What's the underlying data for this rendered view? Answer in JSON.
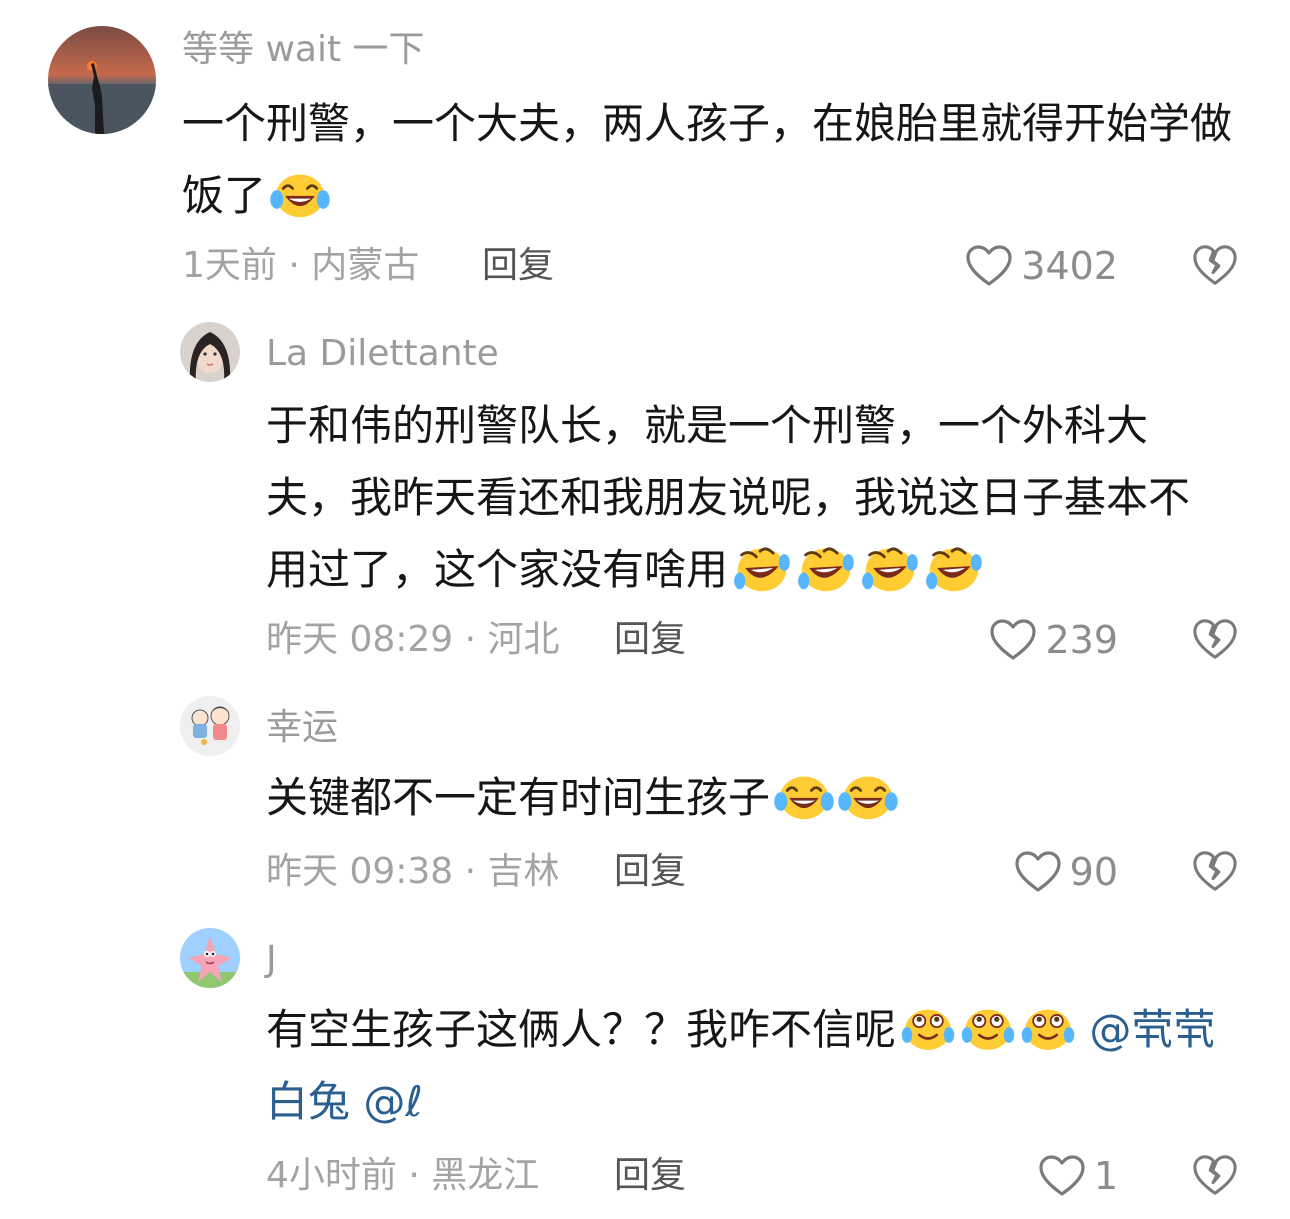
{
  "comments": [
    {
      "username": "等等 wait 一下",
      "text": "一个刑警，一个大夫，两人孩子，在娘胎里就得开始学做饭了",
      "emoji": "laugh-cry",
      "emoji_count": 1,
      "time_location": "1天前 · 内蒙古",
      "reply_label": "回复",
      "likes": "3402",
      "avatar": "sunset-silhouette-avatar"
    },
    {
      "username": "La  Dilettante",
      "text": "于和伟的刑警队长，就是一个刑警，一个外科大夫，我昨天看还和我朋友说呢，我说这日子基本不用过了，这个家没有啥用",
      "emoji": "rofl",
      "emoji_count": 4,
      "time_location": "昨天 08:29 · 河北",
      "reply_label": "回复",
      "likes": "239",
      "avatar": "girl-portrait-avatar"
    },
    {
      "username": "幸运",
      "text": "关键都不一定有时间生孩子",
      "emoji": "laugh-cry",
      "emoji_count": 2,
      "time_location": "昨天 09:38 · 吉林",
      "reply_label": "回复",
      "likes": "90",
      "avatar": "cartoon-kids-avatar"
    },
    {
      "username": "J",
      "text": "有空生孩子这俩人？？我咋不信呢",
      "emoji": "tearful-laugh",
      "emoji_count": 3,
      "mentions": [
        "@茕茕白兔",
        "@ℓ"
      ],
      "time_location": "4小时前 · 黑龙江",
      "reply_label": "回复",
      "likes": "1",
      "avatar": "patrick-star-avatar"
    }
  ],
  "colors": {
    "username": "#9b9b9b",
    "content": "#161616",
    "meta": "#a3a3a3",
    "mention": "#2a5f8f"
  }
}
